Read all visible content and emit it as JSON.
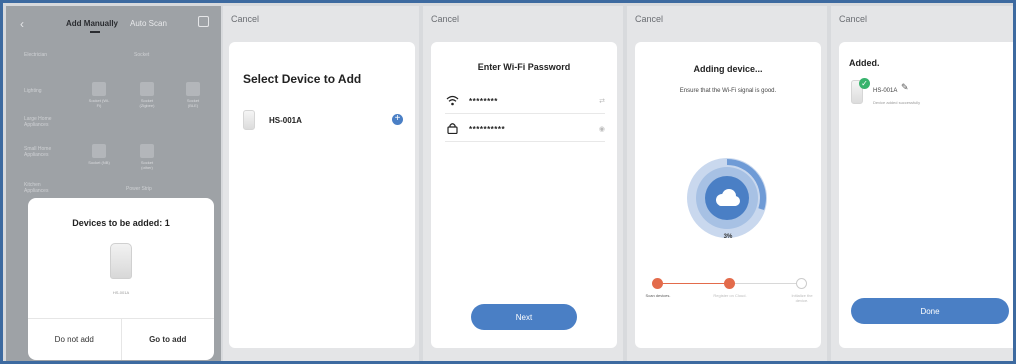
{
  "screen1": {
    "back_icon": "chevron-left-icon",
    "tab_manual": "Add Manually",
    "tab_scan": "Auto Scan",
    "scan_icon": "scan-icon",
    "categories": [
      "Electrician",
      "Lighting",
      "Large Home Appliances",
      "Small Home Appliances",
      "Kitchen Appliances"
    ],
    "subhead1": "Socket",
    "subhead2": "Power Strip",
    "items": [
      {
        "label": "Socket (Wi-Fi)"
      },
      {
        "label": "Socket (Zigbee)"
      },
      {
        "label": "Socket (BLE)"
      },
      {
        "label": "Socket (NB)"
      },
      {
        "label": "Socket (other)"
      }
    ],
    "sheet": {
      "title": "Devices to be added: 1",
      "device_name": "HS-001A",
      "do_not_add": "Do not add",
      "go_to_add": "Go to add"
    }
  },
  "screen2": {
    "cancel": "Cancel",
    "title": "Select Device to Add",
    "device": "HS-001A"
  },
  "screen3": {
    "cancel": "Cancel",
    "title": "Enter Wi-Fi Password",
    "ssid": "********",
    "password": "**********",
    "next": "Next"
  },
  "screen4": {
    "cancel": "Cancel",
    "title": "Adding device...",
    "subtitle": "Ensure that the Wi-Fi signal is good.",
    "percent": "3%",
    "progress": 0.03,
    "steps": [
      "Scan devices.",
      "Register on Cloud.",
      "Initialize the device."
    ]
  },
  "screen5": {
    "cancel": "Cancel",
    "title": "Added.",
    "device": "HS-001A",
    "status": "Device added successfully",
    "done": "Done"
  },
  "colors": {
    "accent": "#4a7fc5",
    "step_done": "#e36b4b",
    "success": "#38b36d"
  }
}
